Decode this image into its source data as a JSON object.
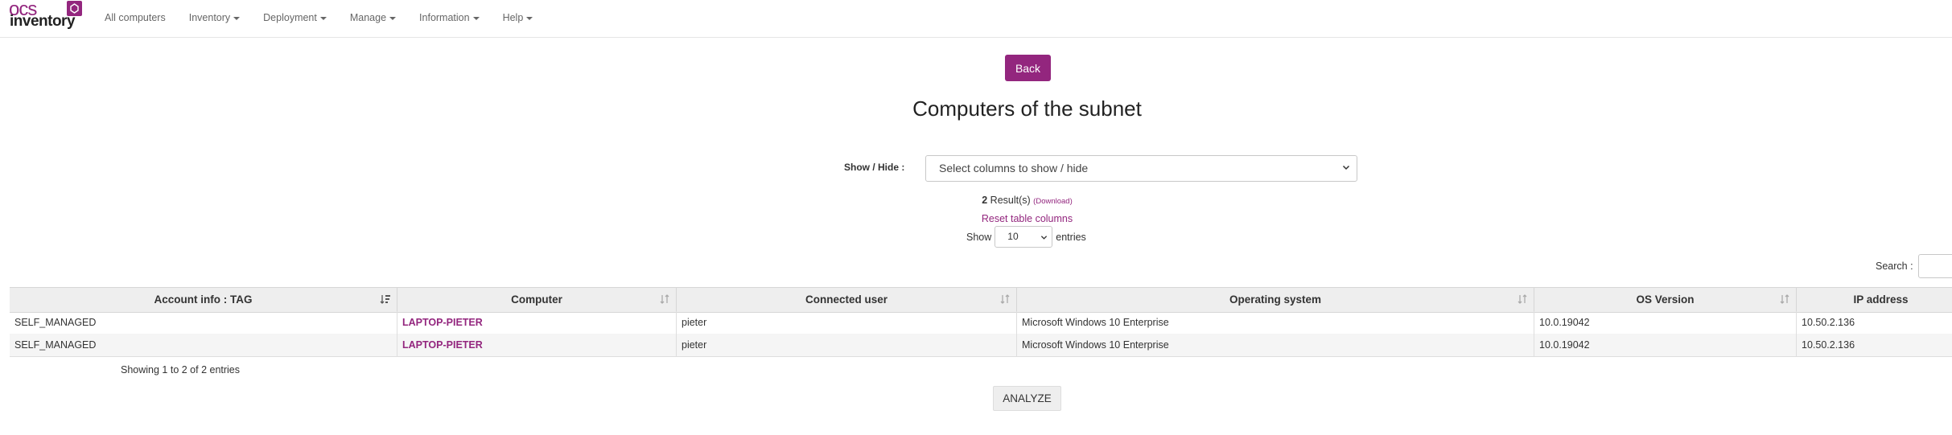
{
  "brand": {
    "logo_top": "ocs",
    "logo_bottom": "inventory",
    "accent": "#93267e"
  },
  "nav": [
    {
      "label": "All computers",
      "dropdown": false
    },
    {
      "label": "Inventory",
      "dropdown": true
    },
    {
      "label": "Deployment",
      "dropdown": true
    },
    {
      "label": "Manage",
      "dropdown": true
    },
    {
      "label": "Information",
      "dropdown": true
    },
    {
      "label": "Help",
      "dropdown": true
    }
  ],
  "back_label": "Back",
  "page_title": "Computers of the subnet",
  "showhide": {
    "label": "Show / Hide :",
    "placeholder": "Select columns to show / hide"
  },
  "results": {
    "count": "2",
    "text": " Result(s)",
    "download": "(Download)"
  },
  "reset_label": "Reset table columns",
  "entries": {
    "show": "Show",
    "value": "10",
    "suffix": "entries"
  },
  "search_label": "Search :",
  "table": {
    "columns": [
      "Account info : TAG",
      "Computer",
      "Connected user",
      "Operating system",
      "OS Version",
      "IP address"
    ],
    "rows": [
      [
        "SELF_MANAGED",
        "LAPTOP-PIETER",
        "pieter",
        "Microsoft Windows 10 Enterprise",
        "10.0.19042",
        "10.50.2.136"
      ],
      [
        "SELF_MANAGED",
        "LAPTOP-PIETER",
        "pieter",
        "Microsoft Windows 10 Enterprise",
        "10.0.19042",
        "10.50.2.136"
      ]
    ]
  },
  "showing_text": "Showing 1 to 2 of 2 entries",
  "analyze_label": "ANALYZE"
}
